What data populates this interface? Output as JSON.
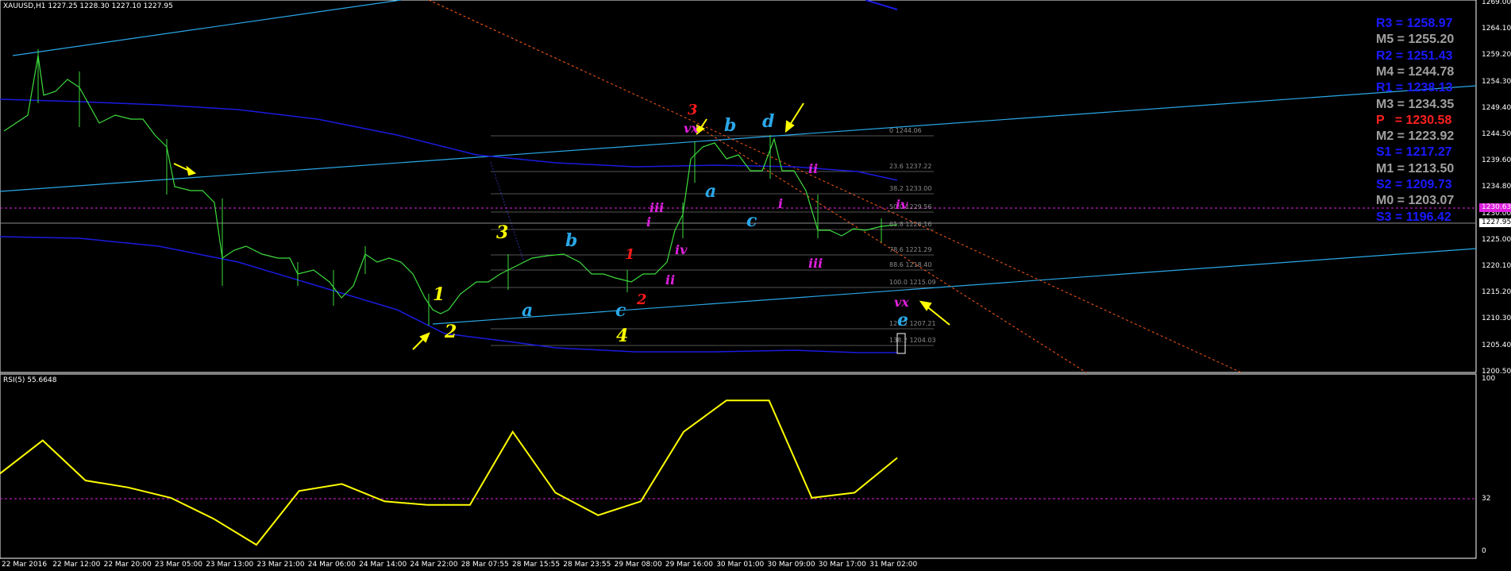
{
  "header": {
    "symbol_line": "XAUUSD,H1  1227.25 1228.30 1227.10 1227.95",
    "rsi_line": "RSI(5) 55.6648"
  },
  "pivots": [
    {
      "label": "R3 = 1258.97",
      "color": "#1a1aff"
    },
    {
      "label": "M5 = 1255.20",
      "color": "#a0a0a0"
    },
    {
      "label": "R2 = 1251.43",
      "color": "#1a1aff"
    },
    {
      "label": "M4 = 1244.78",
      "color": "#a0a0a0"
    },
    {
      "label": "R1 = 1238.13",
      "color": "#1a1aff"
    },
    {
      "label": "M3 = 1234.35",
      "color": "#a0a0a0"
    },
    {
      "label": "P   = 1230.58",
      "color": "#ff2020"
    },
    {
      "label": "M2 = 1223.92",
      "color": "#a0a0a0"
    },
    {
      "label": "S1 = 1217.27",
      "color": "#1a1aff"
    },
    {
      "label": "M1 = 1213.50",
      "color": "#a0a0a0"
    },
    {
      "label": "S2 = 1209.73",
      "color": "#1a1aff"
    },
    {
      "label": "M0 = 1203.07",
      "color": "#a0a0a0"
    },
    {
      "label": "S3 = 1196.42",
      "color": "#1a1aff"
    }
  ],
  "price_axis": [
    "1269.00",
    "1264.10",
    "1259.20",
    "1254.30",
    "1249.40",
    "1244.50",
    "1239.60",
    "1234.80",
    "1230.00",
    "1225.00",
    "1220.10",
    "1215.20",
    "1210.30",
    "1205.40",
    "1200.50"
  ],
  "rsi_axis": [
    "100",
    "32",
    "0"
  ],
  "price_tags": {
    "current": "1227.95",
    "line": "1230.63"
  },
  "time_axis": [
    "22 Mar 2016",
    "22 Mar 12:00",
    "22 Mar 20:00",
    "23 Mar 05:00",
    "23 Mar 13:00",
    "23 Mar 21:00",
    "24 Mar 06:00",
    "24 Mar 14:00",
    "24 Mar 22:00",
    "28 Mar 07:55",
    "28 Mar 15:55",
    "28 Mar 23:55",
    "29 Mar 08:00",
    "29 Mar 16:00",
    "30 Mar 01:00",
    "30 Mar 09:00",
    "30 Mar 17:00",
    "31 Mar 02:00"
  ],
  "fib_labels": [
    "0 1244.06",
    "23.6 1237.22",
    "38.2 1233.00",
    "50.0 1229.56",
    "61.8 1226.16",
    "78.6 1221.29",
    "88.6 1218.40",
    "100.0 1215.09",
    "127.2 1207.21",
    "138.2 1204.03"
  ],
  "wave_labels": [
    {
      "t": "1",
      "color": "#ffff00"
    },
    {
      "t": "2",
      "color": "#ffff00"
    },
    {
      "t": "3",
      "color": "#ffff00"
    },
    {
      "t": "4",
      "color": "#ffff00"
    },
    {
      "t": "a",
      "color": "#2aa8e8"
    },
    {
      "t": "b",
      "color": "#2aa8e8"
    },
    {
      "t": "c",
      "color": "#2aa8e8"
    },
    {
      "t": "a",
      "color": "#2aa8e8"
    },
    {
      "t": "b",
      "color": "#2aa8e8"
    },
    {
      "t": "c",
      "color": "#2aa8e8"
    },
    {
      "t": "d",
      "color": "#2aa8e8"
    },
    {
      "t": "e",
      "color": "#2aa8e8"
    },
    {
      "t": "1",
      "color": "#ff1a1a"
    },
    {
      "t": "2",
      "color": "#ff1a1a"
    },
    {
      "t": "3",
      "color": "#ff1a1a"
    },
    {
      "t": "i",
      "color": "#e020e0"
    },
    {
      "t": "ii",
      "color": "#e020e0"
    },
    {
      "t": "iii",
      "color": "#e020e0"
    },
    {
      "t": "iv",
      "color": "#e020e0"
    },
    {
      "t": "vx",
      "color": "#e020e0"
    },
    {
      "t": "i",
      "color": "#e020e0"
    },
    {
      "t": "ii",
      "color": "#e020e0"
    },
    {
      "t": "iii",
      "color": "#e020e0"
    },
    {
      "t": "iv",
      "color": "#e020e0"
    },
    {
      "t": "vx",
      "color": "#e020e0"
    }
  ],
  "chart_data": [
    {
      "type": "line",
      "name": "price",
      "ylim": [
        1200.5,
        1269.0
      ],
      "x": [
        "22 Mar 2016",
        "22 Mar 12:00",
        "22 Mar 20:00",
        "23 Mar 05:00",
        "23 Mar 13:00",
        "23 Mar 21:00",
        "24 Mar 06:00",
        "24 Mar 14:00",
        "24 Mar 22:00",
        "28 Mar 07:55",
        "28 Mar 15:55",
        "28 Mar 23:55",
        "29 Mar 08:00",
        "29 Mar 16:00",
        "30 Mar 01:00",
        "30 Mar 09:00",
        "30 Mar 17:00",
        "31 Mar 02:00"
      ],
      "series": [
        {
          "values": [
            1245.0,
            1252.5,
            1246.0,
            1236.0,
            1222.0,
            1221.0,
            1219.0,
            1223.0,
            1211.0,
            1218.0,
            1222.0,
            1220.0,
            1218.0,
            1242.0,
            1240.0,
            1240.0,
            1226.5,
            1227.95
          ]
        }
      ]
    },
    {
      "type": "line",
      "name": "RSI",
      "ylim": [
        0,
        100
      ],
      "series": [
        {
          "values": [
            46,
            65,
            42,
            38,
            32,
            20,
            5,
            36,
            40,
            30,
            28,
            28,
            70,
            35,
            22,
            30,
            70,
            88,
            88,
            32,
            35,
            55
          ]
        }
      ]
    }
  ]
}
